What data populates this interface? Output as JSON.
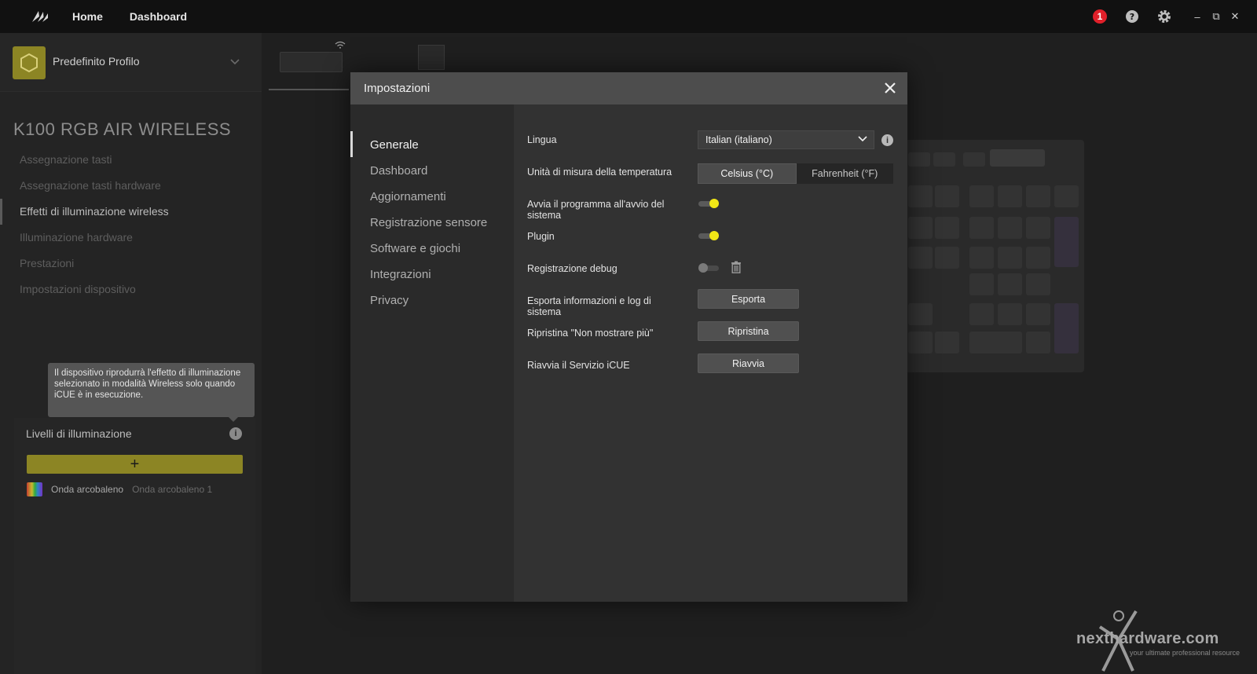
{
  "topbar": {
    "nav": [
      "Home",
      "Dashboard"
    ],
    "notification_count": "1"
  },
  "sidebar": {
    "profile_name": "Predefinito Profilo",
    "device_title": "K100 RGB AIR WIRELESS",
    "menu": [
      "Assegnazione tasti",
      "Assegnazione tasti hardware",
      "Effetti di illuminazione wireless",
      "Illuminazione hardware",
      "Prestazioni",
      "Impostazioni dispositivo"
    ],
    "active_index": 2,
    "tooltip": "Il dispositivo riprodurrà l'effetto di illuminazione selezionato in modalità Wireless solo quando iCUE è in esecuzione.",
    "layers_title": "Livelli di illuminazione",
    "layers_add": "+",
    "layer_name": "Onda arcobaleno",
    "layer_sub": "Onda arcobaleno 1"
  },
  "modal": {
    "title": "Impostazioni",
    "nav": [
      "Generale",
      "Dashboard",
      "Aggiornamenti",
      "Registrazione sensore",
      "Software e giochi",
      "Integrazioni",
      "Privacy"
    ],
    "active_nav": "Generale",
    "settings": {
      "language_label": "Lingua",
      "language_value": "Italian (italiano)",
      "temp_label": "Unità di misura della temperatura",
      "temp_options": [
        "Celsius (°C)",
        "Fahrenheit (°F)"
      ],
      "temp_selected": "Celsius (°C)",
      "startup_label": "Avvia il programma all'avvio del sistema",
      "startup_on": true,
      "plugin_label": "Plugin",
      "plugin_on": true,
      "debug_label": "Registrazione debug",
      "debug_on": false,
      "export_label": "Esporta informazioni e log di sistema",
      "export_button": "Esporta",
      "reset_label": "Ripristina \"Non mostrare più\"",
      "reset_button": "Ripristina",
      "restart_label": "Riavvia il Servizio iCUE",
      "restart_button": "Riavvia"
    }
  },
  "colors": {
    "accent_yellow": "#f1e716",
    "profile_gold": "#8c8524",
    "badge_red": "#e0202a"
  },
  "watermark": {
    "text": "nexthardware.com",
    "sub": "your ultimate professional resource"
  }
}
